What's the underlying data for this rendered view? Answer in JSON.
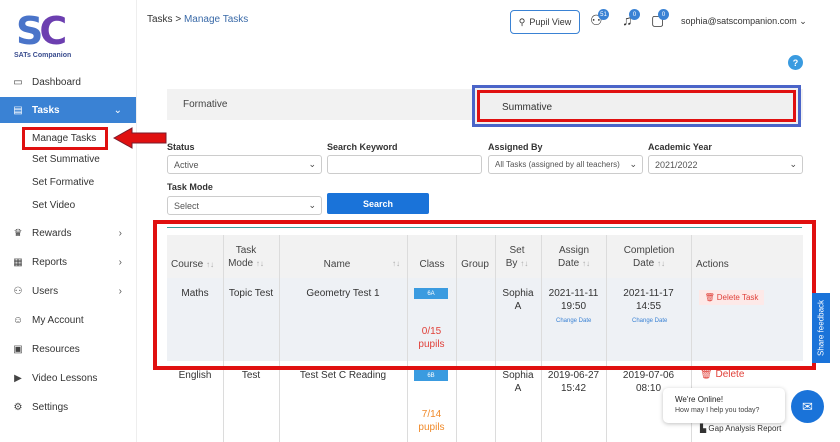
{
  "app": {
    "logo_mark_a": "S",
    "logo_mark_b": "C",
    "logo_text": "SATs Companion"
  },
  "sidebar": {
    "items": [
      {
        "label": "Dashboard",
        "icon": "monitor-icon"
      },
      {
        "label": "Tasks",
        "icon": "tasks-icon",
        "active": true
      },
      {
        "label": "Rewards",
        "icon": "trophy-icon"
      },
      {
        "label": "Reports",
        "icon": "reports-icon"
      },
      {
        "label": "Users",
        "icon": "users-icon"
      },
      {
        "label": "My Account",
        "icon": "account-icon"
      },
      {
        "label": "Resources",
        "icon": "resources-icon"
      },
      {
        "label": "Video Lessons",
        "icon": "video-icon"
      },
      {
        "label": "Settings",
        "icon": "gear-icon"
      }
    ],
    "subitems": [
      "Manage Tasks",
      "Set Summative",
      "Set Formative",
      "Set Video"
    ]
  },
  "header": {
    "breadcrumb_root": "Tasks",
    "breadcrumb_sep": " > ",
    "breadcrumb_current": "Manage Tasks",
    "pupil_view": "Pupil View",
    "badge_users": "51",
    "badge_bell": "0",
    "badge_chat": "0",
    "email": "sophia@satscompanion.com"
  },
  "tabs": {
    "formative": "Formative",
    "summative": "Summative"
  },
  "filters": {
    "status_label": "Status",
    "status_value": "Active",
    "keyword_label": "Search Keyword",
    "assigned_label": "Assigned By",
    "assigned_value": "All Tasks (assigned by all teachers)",
    "year_label": "Academic Year",
    "year_value": "2021/2022",
    "mode_label": "Task Mode",
    "mode_value": "Select",
    "search_button": "Search"
  },
  "table": {
    "headers": {
      "course": "Course",
      "mode_1": "Task",
      "mode_2": "Mode",
      "name": "Name",
      "class": "Class",
      "group": "Group",
      "setby_1": "Set",
      "setby_2": "By",
      "assign_1": "Assign",
      "assign_2": "Date",
      "completion_1": "Completion",
      "completion_2": "Date",
      "actions": "Actions"
    },
    "rows": [
      {
        "course": "Maths",
        "mode": "Topic Test",
        "name": "Geometry Test 1",
        "class": "6A",
        "pupils_1": "0/15",
        "pupils_2": "pupils",
        "setby_1": "Sophia",
        "setby_2": "A",
        "assign_date": "2021-11-11",
        "assign_time": "19:50",
        "assign_change": "Change Date",
        "completion_date": "2021-11-17",
        "completion_time": "14:55",
        "completion_change": "Change Date",
        "action": "Delete Task"
      },
      {
        "course": "English",
        "mode": "Test",
        "name": "Test Set C Reading",
        "class": "6B",
        "pupils_1": "7/14",
        "pupils_2": "pupils",
        "setby_1": "Sophia",
        "setby_2": "A",
        "assign_date": "2019-06-27",
        "assign_time": "15:42",
        "completion_date": "2019-07-06",
        "completion_time": "08:10",
        "action": "Delete"
      }
    ],
    "footer_link": "Gap Analysis Report"
  },
  "widgets": {
    "feedback": "Share feedback",
    "chat_title": "We're Online!",
    "chat_sub": "How may I help you today?",
    "help": "?"
  },
  "colors": {
    "accent": "#3a82d4",
    "highlight": "#e01010",
    "delete": "#e0413a"
  }
}
